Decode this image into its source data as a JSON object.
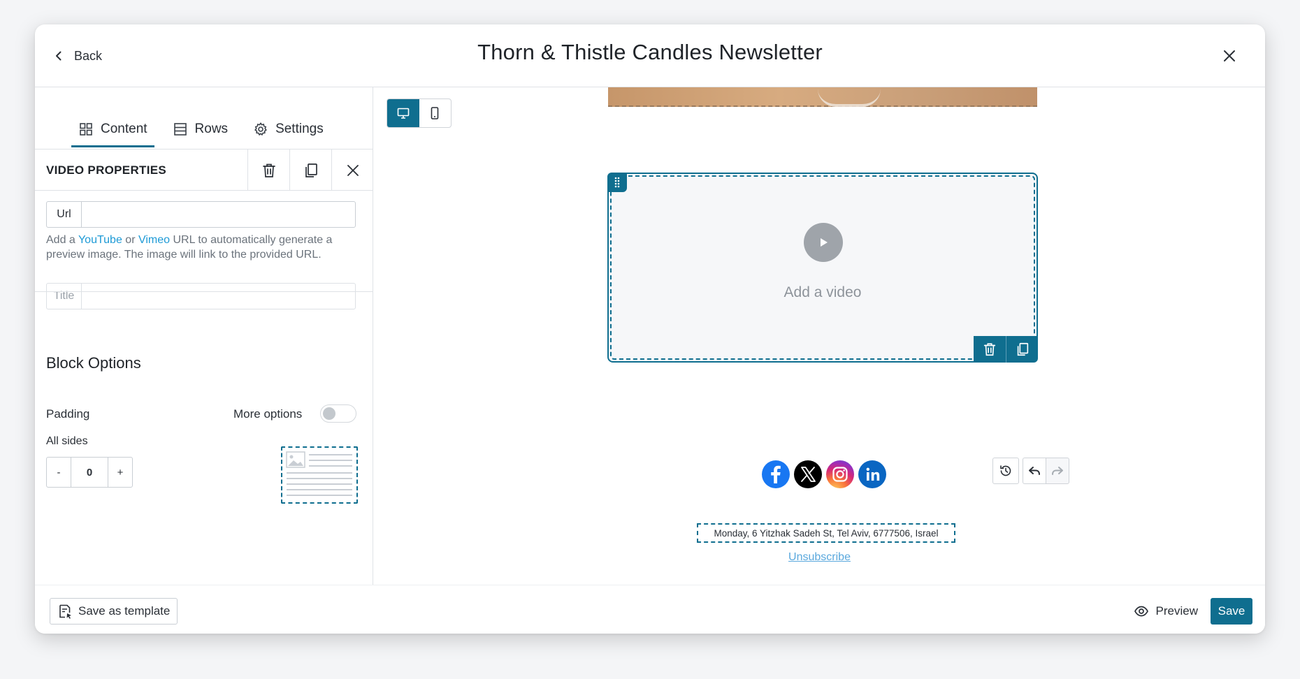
{
  "header": {
    "back_label": "Back",
    "title": "Thorn & Thistle Candles Newsletter"
  },
  "tabs": [
    {
      "label": "Content",
      "icon": "grid-icon",
      "active": true
    },
    {
      "label": "Rows",
      "icon": "rows-icon",
      "active": false
    },
    {
      "label": "Settings",
      "icon": "gear-icon",
      "active": false
    }
  ],
  "properties": {
    "title": "VIDEO PROPERTIES",
    "url_label": "Url",
    "url_value": "",
    "help_prefix": "Add a ",
    "help_youtube": "YouTube",
    "help_or": " or ",
    "help_vimeo": "Vimeo",
    "help_suffix": " URL to automatically generate a preview image. The image will link to the provided URL.",
    "title_label": "Title",
    "title_value": ""
  },
  "block_options": {
    "heading": "Block Options",
    "padding_label": "Padding",
    "more_options_label": "More options",
    "more_options_on": false,
    "all_sides_label": "All sides",
    "decrement": "-",
    "padding_value": "0",
    "increment": "+"
  },
  "canvas": {
    "video_placeholder": "Add a video",
    "social": [
      "facebook-icon",
      "x-icon",
      "instagram-icon",
      "linkedin-icon"
    ],
    "address": "Monday, 6 Yitzhak Sadeh St, Tel Aviv, 6777506, Israel",
    "unsubscribe": "Unsubscribe"
  },
  "footer": {
    "save_template": "Save as template",
    "preview": "Preview",
    "save": "Save"
  },
  "colors": {
    "accent": "#0f6e8f",
    "link": "#1d9ad6",
    "facebook": "#1877f2",
    "linkedin": "#0a66c2"
  }
}
